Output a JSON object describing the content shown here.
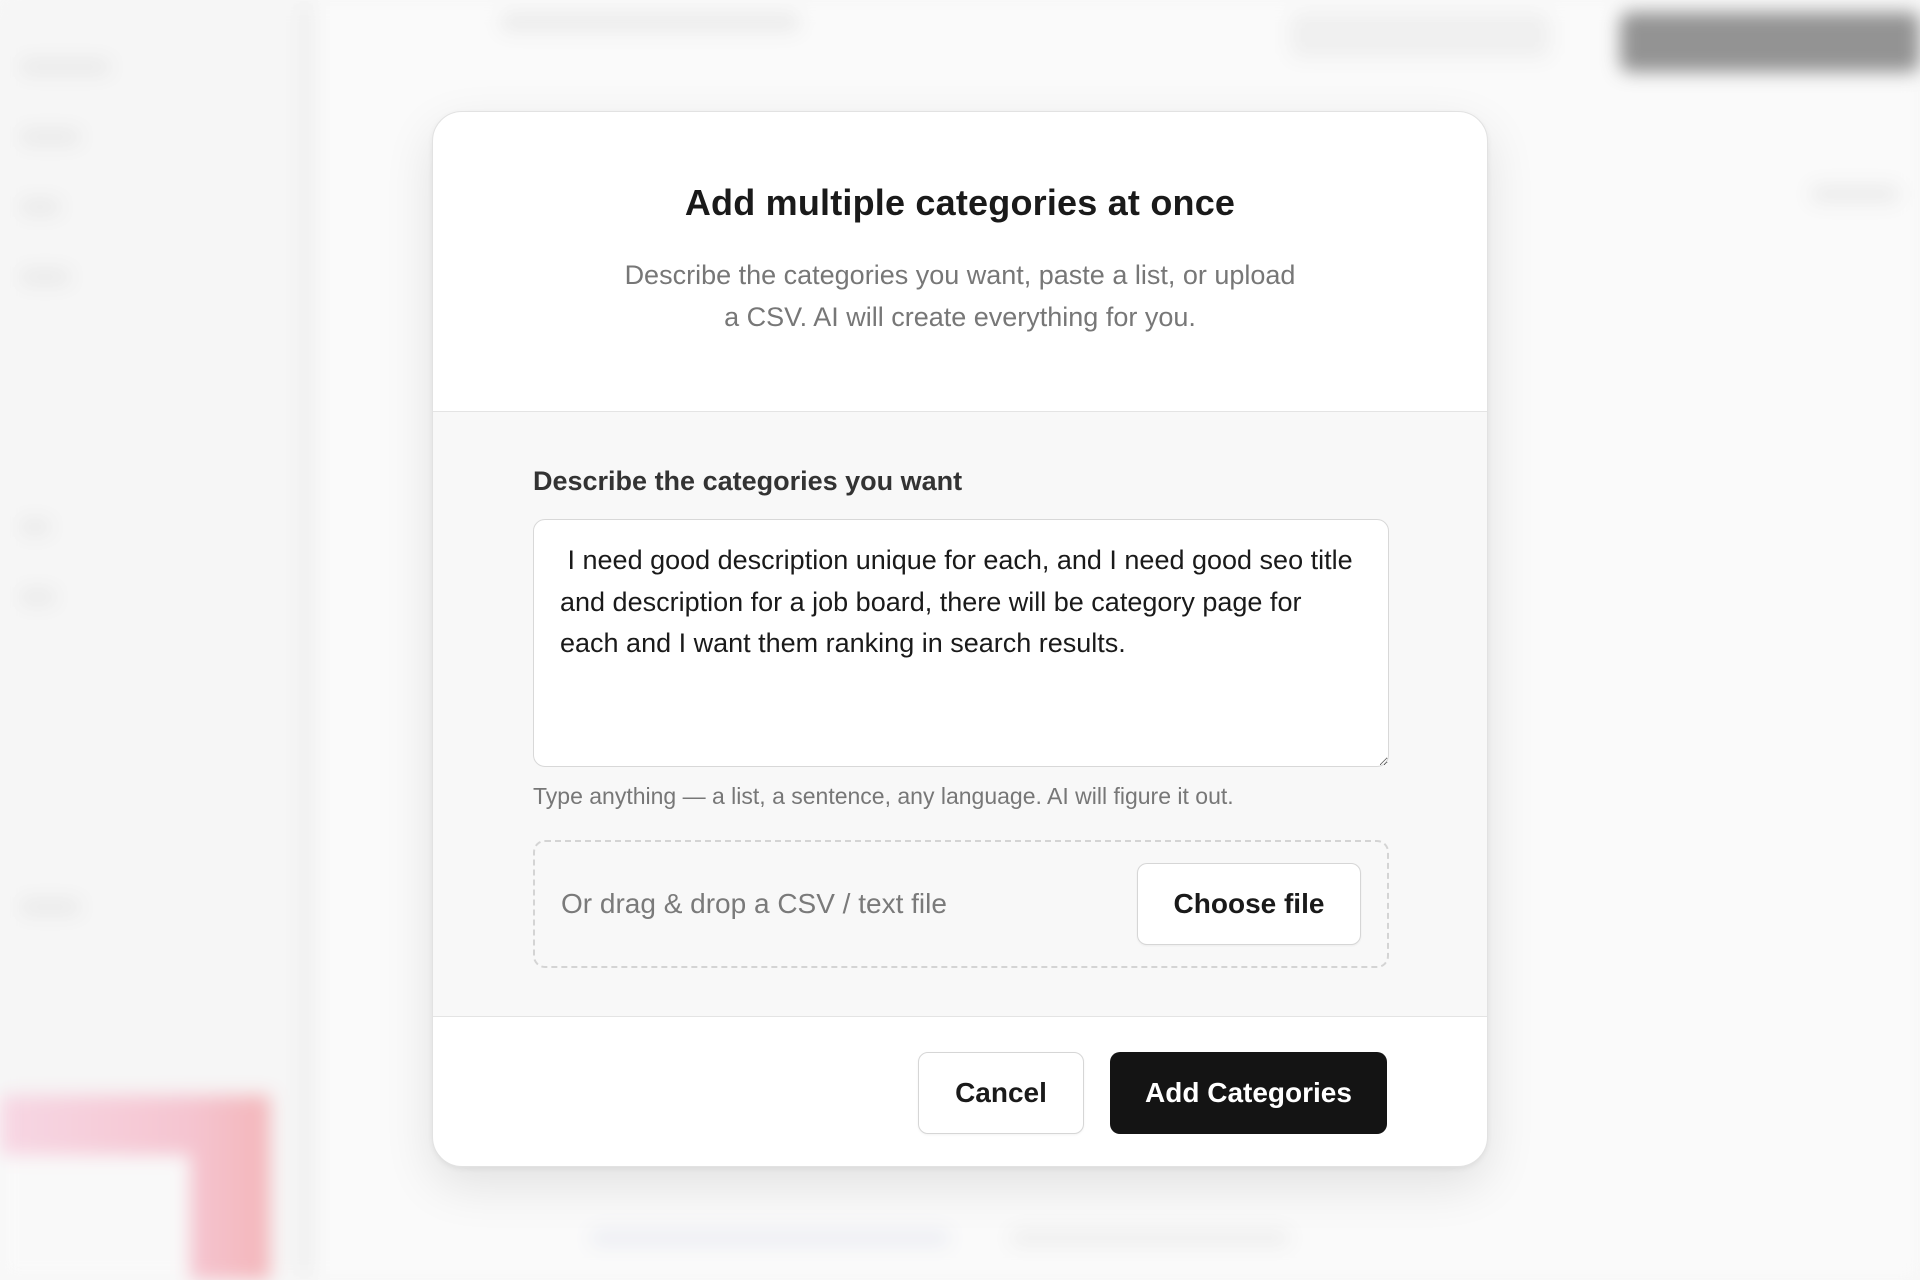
{
  "modal": {
    "title": "Add multiple categories at once",
    "subtitle": "Describe the categories you want, paste a list, or upload a CSV. AI will create everything for you.",
    "field_label": "Describe the categories you want",
    "textarea_value": " I need good description unique for each, and I need good seo title and description for a job board, there will be category page for each and I want them ranking in search results.",
    "hint": "Type anything — a list, a sentence, any language. AI will figure it out.",
    "dropzone_text": "Or drag & drop a CSV / text file",
    "choose_file_label": "Choose file",
    "cancel_label": "Cancel",
    "submit_label": "Add Categories"
  },
  "colors": {
    "primary_button": "#141414",
    "body_background": "#f8f8f8"
  }
}
